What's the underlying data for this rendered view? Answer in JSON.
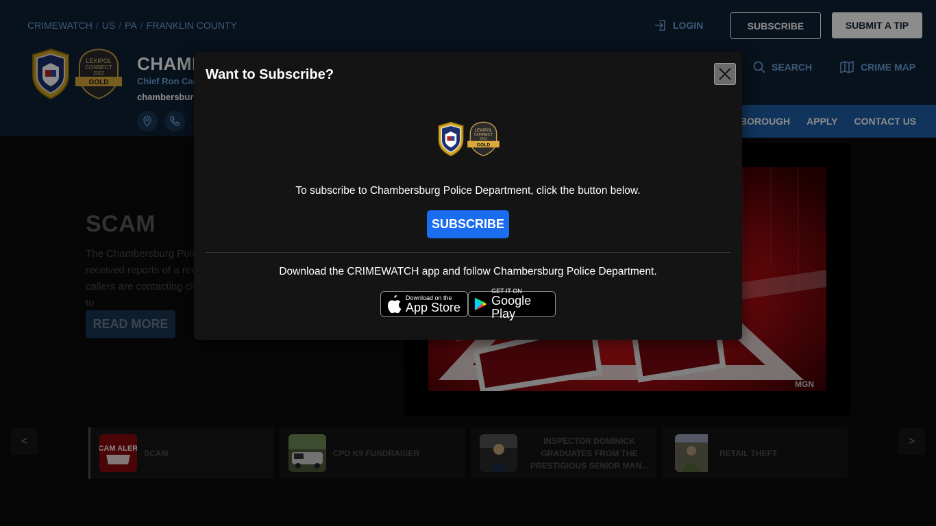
{
  "breadcrumb": [
    "CRIMEWATCH",
    "US",
    "PA",
    "FRANKLIN COUNTY"
  ],
  "header": {
    "login_label": "LOGIN",
    "subscribe_label": "SUBSCRIBE",
    "submit_tip_label": "SUBMIT A TIP",
    "agency_name": "CHAMBERSBURG POLICE DEPARTMENT",
    "chief": "Chief Ron Camacho",
    "domain": "chambersburg.crimewatchpa.com",
    "search_label": "SEARCH",
    "crime_map_label": "CRIME MAP",
    "logo_badge_lines": [
      "LEXIPOL",
      "CONNECT",
      "2022",
      "GOLD"
    ]
  },
  "nav": {
    "items": [
      "BOROUGH",
      "APPLY",
      "CONTACT US"
    ]
  },
  "hero": {
    "title": "SCAM",
    "text": "The Chambersburg Police Department has received reports of a recent scam where callers are contacting citizens in an attempt to",
    "read_more_label": "READ MORE",
    "image_watermark": "MGN"
  },
  "carousel": {
    "prev_label": "<",
    "next_label": ">",
    "items": [
      {
        "label": "SCAM",
        "thumb_text": "SCAM ALERT"
      },
      {
        "label": "CPD K9 FUNDRAISER"
      },
      {
        "label": "INSPECTOR DOMINICK GRADUATES FROM THE PRESTIGIOUS SENIOR MAN..."
      },
      {
        "label": "RETAIL THEFT"
      }
    ]
  },
  "modal": {
    "title": "Want to Subscribe?",
    "message": "To subscribe to Chambersburg Police Department, click the button below.",
    "subscribe_label": "SUBSCRIBE",
    "app_message": "Download the CRIMEWATCH app and follow Chambersburg Police Department.",
    "app_store_small": "Download on the",
    "app_store_big": "App Store",
    "google_play_small": "GET IT ON",
    "google_play_big": "Google Play"
  },
  "colors": {
    "header_bg": "#0f2136",
    "link_blue": "#6fa4dc",
    "nav_blue": "#1f5fa8",
    "primary_button": "#1a6cf0",
    "modal_bg": "#141414"
  }
}
